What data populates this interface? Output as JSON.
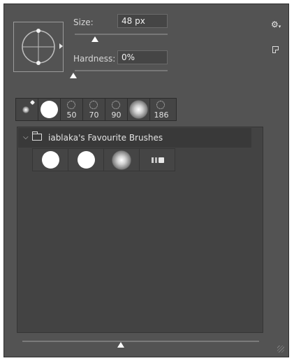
{
  "size": {
    "label": "Size:",
    "value": "48 px"
  },
  "hardness": {
    "label": "Hardness:",
    "value": "0%"
  },
  "recent_brushes": [
    {
      "type": "soft-small-pencil",
      "number": ""
    },
    {
      "type": "hard-round",
      "number": ""
    },
    {
      "type": "scatter",
      "number": "50"
    },
    {
      "type": "scatter",
      "number": "70"
    },
    {
      "type": "scatter",
      "number": "90"
    },
    {
      "type": "soft-round",
      "number": ""
    },
    {
      "type": "scatter",
      "number": "186"
    }
  ],
  "group": {
    "name": "iablaka's Favourite Brushes",
    "brushes": [
      "hard-round",
      "hard-round-2",
      "soft-round",
      "special"
    ]
  },
  "icons": {
    "settings": "gear-icon",
    "new": "new-preset-icon",
    "folder": "folder-icon",
    "chevron": "chevron-down-icon"
  }
}
